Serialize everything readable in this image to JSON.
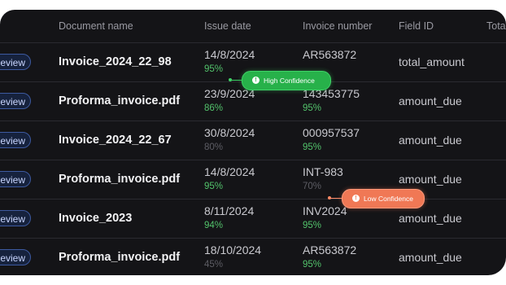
{
  "table": {
    "columns": [
      "Document name",
      "Issue date",
      "Invoice number",
      "Field ID",
      "Tota"
    ],
    "rows": [
      {
        "action": "eview",
        "document_name": "Invoice_2024_22_98",
        "issue_date": "14/8/2024",
        "date_confidence": "95%",
        "invoice_number": "AR563872",
        "invoice_confidence": "",
        "field_id": "total_amount"
      },
      {
        "action": "eview",
        "document_name": "Proforma_invoice.pdf",
        "issue_date": "23/9/2024",
        "date_confidence": "86%",
        "invoice_number": "143453775",
        "invoice_confidence": "95%",
        "field_id": "amount_due"
      },
      {
        "action": "eview",
        "document_name": "Invoice_2024_22_67",
        "issue_date": "30/8/2024",
        "date_confidence": "80%",
        "invoice_number": "000957537",
        "invoice_confidence": "95%",
        "field_id": "amount_due"
      },
      {
        "action": "eview",
        "document_name": "Proforma_invoice.pdf",
        "issue_date": "14/8/2024",
        "date_confidence": "95%",
        "invoice_number": "INT-983",
        "invoice_confidence": "70%",
        "field_id": "amount_due"
      },
      {
        "action": "eview",
        "document_name": "Invoice_2023",
        "issue_date": "8/11/2024",
        "date_confidence": "94%",
        "invoice_number": "INV2024",
        "invoice_confidence": "95%",
        "field_id": "amount_due"
      },
      {
        "action": "eview",
        "document_name": "Proforma_invoice.pdf",
        "issue_date": "18/10/2024",
        "date_confidence": "45%",
        "invoice_number": "AR563872",
        "invoice_confidence": "95%",
        "field_id": "amount_due"
      }
    ]
  },
  "badges": {
    "high": {
      "label": "High Confidence",
      "icon": "info-icon",
      "color": "#27b14a"
    },
    "low": {
      "label": "Low Confidence",
      "icon": "info-icon",
      "color": "#f07855"
    }
  },
  "colors": {
    "background": "#141417",
    "confidence_good": "#52c26b",
    "confidence_low": "#5d5d64",
    "button_border": "#3d5aa0"
  }
}
